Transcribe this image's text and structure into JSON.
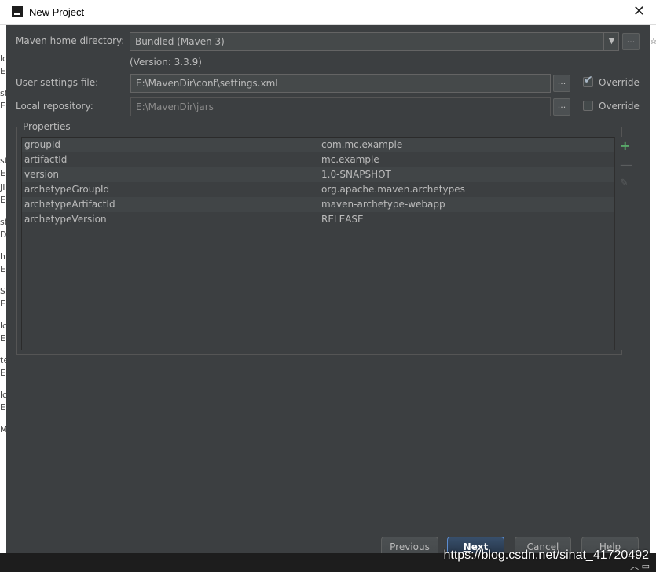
{
  "window": {
    "title": "New Project",
    "close_glyph": "✕",
    "logo_icon": "intellij-logo-icon"
  },
  "maven": {
    "home_label": "Maven home directory:",
    "home_value": "Bundled (Maven 3)",
    "dropdown_glyph": "▼",
    "version_text": "(Version: 3.3.9)",
    "settings_label": "User settings file:",
    "settings_value": "E:\\MavenDir\\conf\\settings.xml",
    "settings_override_label": "Override",
    "settings_override_checked": true,
    "repo_label": "Local repository:",
    "repo_value": "E:\\MavenDir\\jars",
    "repo_override_label": "Override",
    "repo_override_checked": false,
    "browse_glyph": "..."
  },
  "properties": {
    "title": "Properties",
    "rows": [
      {
        "key": "groupId",
        "value": "com.mc.example"
      },
      {
        "key": "artifactId",
        "value": "mc.example"
      },
      {
        "key": "version",
        "value": "1.0-SNAPSHOT"
      },
      {
        "key": "archetypeGroupId",
        "value": "org.apache.maven.archetypes"
      },
      {
        "key": "archetypeArtifactId",
        "value": "maven-archetype-webapp"
      },
      {
        "key": "archetypeVersion",
        "value": "RELEASE"
      }
    ],
    "add_glyph": "+",
    "remove_glyph": "—",
    "edit_glyph": "✎"
  },
  "buttons": {
    "previous_label": "Previous",
    "next_mnemonic": "N",
    "next_rest": "ext",
    "cancel_label": "Cancel",
    "help_label": "Help"
  },
  "watermark": "https://blog.csdn.net/sinat_41720492",
  "colors": {
    "dialog_bg": "#3c3f41",
    "text": "#bbbbbb",
    "add_green": "#59a869",
    "primary_border": "#5c8ccf"
  }
}
